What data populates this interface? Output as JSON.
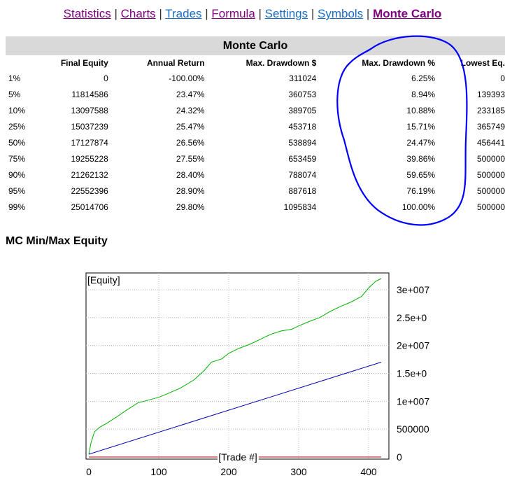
{
  "nav": {
    "items": [
      {
        "label": "Statistics",
        "state": "visited"
      },
      {
        "label": "Charts",
        "state": "visited"
      },
      {
        "label": "Trades",
        "state": "link"
      },
      {
        "label": "Formula",
        "state": "visited"
      },
      {
        "label": "Settings",
        "state": "link"
      },
      {
        "label": "Symbols",
        "state": "link"
      },
      {
        "label": "Monte Carlo",
        "state": "active"
      }
    ],
    "separator": "|"
  },
  "monte_carlo": {
    "title": "Monte Carlo",
    "columns": [
      "",
      "Final Equity",
      "Annual Return",
      "Max. Drawdown $",
      "Max. Drawdown %",
      "Lowest Eq."
    ],
    "rows": [
      [
        "1%",
        "0",
        "-100.00%",
        "311024",
        "6.25%",
        "0"
      ],
      [
        "5%",
        "11814586",
        "23.47%",
        "360753",
        "8.94%",
        "139393"
      ],
      [
        "10%",
        "13097588",
        "24.32%",
        "389705",
        "10.88%",
        "233185"
      ],
      [
        "25%",
        "15037239",
        "25.47%",
        "453718",
        "15.71%",
        "365749"
      ],
      [
        "50%",
        "17127874",
        "26.56%",
        "538894",
        "24.47%",
        "456441"
      ],
      [
        "75%",
        "19255228",
        "27.55%",
        "653459",
        "39.86%",
        "500000"
      ],
      [
        "90%",
        "21262132",
        "28.40%",
        "788074",
        "59.65%",
        "500000"
      ],
      [
        "95%",
        "22552396",
        "28.90%",
        "887618",
        "76.19%",
        "500000"
      ],
      [
        "99%",
        "25014706",
        "29.80%",
        "1095834",
        "100.00%",
        "500000"
      ]
    ]
  },
  "section_heading": "MC Min/Max Equity",
  "chart_data": {
    "type": "line",
    "title": "[Equity]",
    "xlabel": "[Trade #]",
    "x_ticks": [
      "0",
      "100",
      "200",
      "300",
      "400"
    ],
    "y_ticks": [
      "0",
      "500000",
      "1e+007",
      "1.5e+0",
      "2e+007",
      "2.5e+0",
      "3e+007"
    ],
    "xlim": [
      0,
      420
    ],
    "ylim": [
      0,
      32000000
    ],
    "grid": true,
    "series": [
      {
        "color": "#00b000",
        "x": [
          0,
          3,
          8,
          15,
          25,
          40,
          55,
          70,
          85,
          100,
          115,
          130,
          150,
          165,
          175,
          190,
          200,
          215,
          230,
          245,
          260,
          275,
          290,
          300,
          315,
          330,
          345,
          360,
          375,
          390,
          400,
          410,
          418
        ],
        "y": [
          500000,
          2500000,
          4500000,
          5300000,
          6000000,
          7200000,
          8500000,
          9700000,
          10200000,
          10700000,
          11500000,
          12300000,
          13800000,
          15500000,
          17000000,
          17600000,
          18600000,
          19500000,
          20200000,
          21100000,
          22000000,
          22600000,
          22900000,
          23500000,
          24300000,
          25000000,
          26100000,
          27000000,
          27800000,
          28800000,
          30300000,
          31500000,
          32000000
        ]
      },
      {
        "color": "#0000b0",
        "x": [
          0,
          418
        ],
        "y": [
          500000,
          17000000
        ]
      },
      {
        "color": "#c00000",
        "x": [
          0,
          418
        ],
        "y": [
          0,
          0
        ]
      }
    ]
  },
  "colors": {
    "header_bg": "#d9d9d9",
    "annotation": "#0000ff"
  }
}
